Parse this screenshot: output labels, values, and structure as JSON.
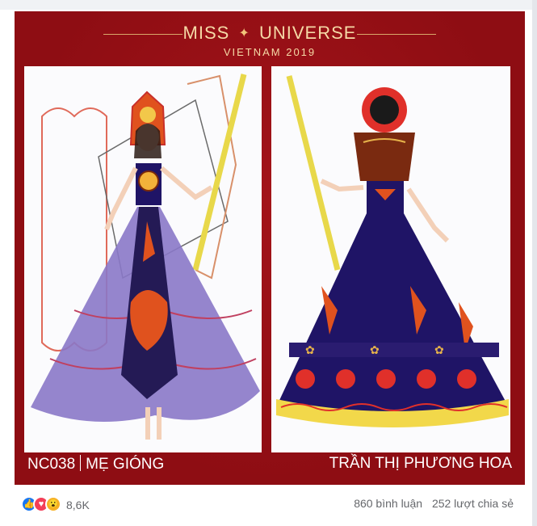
{
  "poster": {
    "brand_title_left": "MISS",
    "brand_star": "✦",
    "brand_title_right": "UNIVERSE",
    "brand_subtitle": "VIETNAM 2019",
    "left_caption_code": "NC038",
    "left_caption_name": "MẸ GIÓNG",
    "right_caption_name": "TRẦN THỊ PHƯƠNG HOA"
  },
  "footer": {
    "reaction_icons": [
      "like-icon",
      "love-icon",
      "wow-icon"
    ],
    "reaction_glyphs": [
      "👍",
      "♥",
      "😮"
    ],
    "reaction_count": "8,6K",
    "comments": "860 bình luận",
    "shares": "252 lượt chia sẻ"
  },
  "colors": {
    "poster_red": "#8e0d13",
    "brand_gold": "#f5d9a6",
    "dress_purple": "#8a78c8",
    "dress_navy": "#1f1466",
    "accent_orange": "#e0521e"
  }
}
